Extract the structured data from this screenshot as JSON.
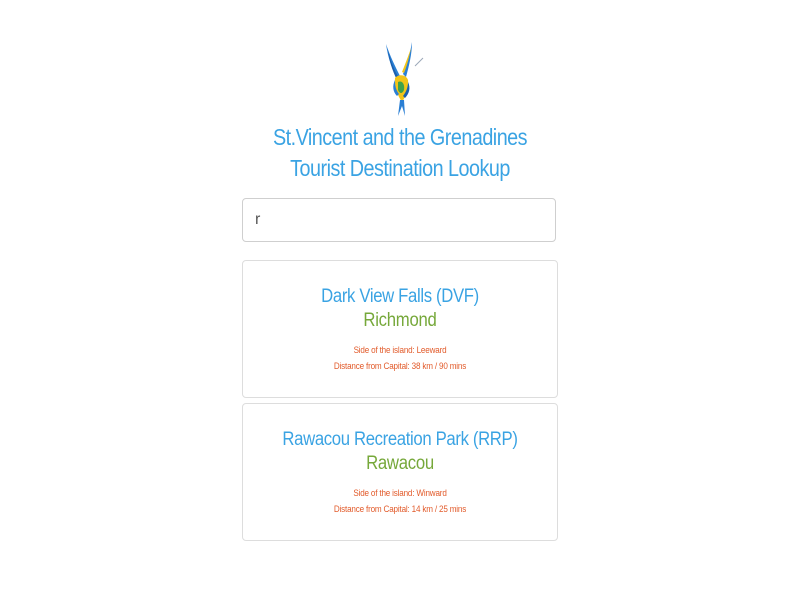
{
  "header": {
    "logo": "hummingbird-logo-icon",
    "title_line1": "St.Vincent and the Grenadines",
    "title_line2": "Tourist Destination Lookup"
  },
  "search": {
    "value": "r",
    "placeholder": ""
  },
  "results": [
    {
      "name": "Dark View Falls (DVF)",
      "town": "Richmond",
      "side": "Side of the island: Leeward",
      "distance": "Distance from Capital: 38 km / 90 mins"
    },
    {
      "name": "Rawacou Recreation Park (RRP)",
      "town": "Rawacou",
      "side": "Side of the island: Winward",
      "distance": "Distance from Capital: 14 km / 25 mins"
    }
  ],
  "colors": {
    "title": "#3aa3e3",
    "town": "#76a83a",
    "detail": "#e25b2b"
  }
}
